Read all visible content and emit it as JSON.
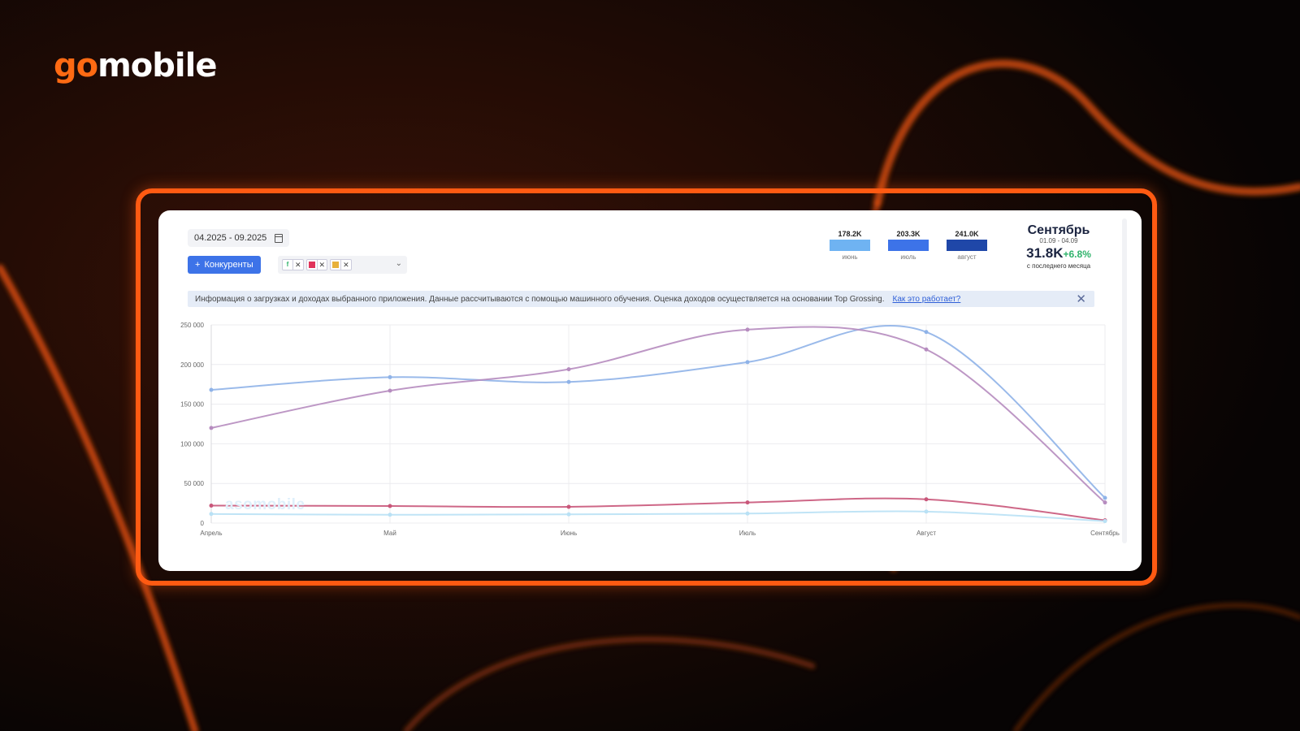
{
  "brand": {
    "logo_go": "go",
    "logo_rest": "mobile"
  },
  "toolbar": {
    "date_range": "04.2025 - 09.2025",
    "competitors_label": "Конкуренты",
    "competitors_plus": "+",
    "competitor_chips": [
      {
        "icon": "f",
        "color": "#2fb36b"
      },
      {
        "icon": "",
        "color": "#e0335a"
      },
      {
        "icon": "",
        "color": "#e8b13a"
      }
    ]
  },
  "stats": [
    {
      "value": "178.2K",
      "label": "июнь",
      "color": "#6fb3f2"
    },
    {
      "value": "203.3K",
      "label": "июль",
      "color": "#3d73e8"
    },
    {
      "value": "241.0K",
      "label": "август",
      "color": "#1f47a8"
    }
  ],
  "summary": {
    "month": "Сентябрь",
    "range": "01.09 - 04.09",
    "total": "31.8K",
    "change": "+6.8%",
    "caption": "с последнего месяца",
    "change_color": "#2fb36b"
  },
  "info": {
    "text": "Информация о загрузках и доходах выбранного приложения. Данные рассчитываются с помощью машинного обучения. Оценка доходов осуществляется на основании Top Grossing.",
    "link": "Как это работает?",
    "close": "✕"
  },
  "watermark": "asomobile",
  "chart_data": {
    "type": "line",
    "categories": [
      "Апрель",
      "Май",
      "Июнь",
      "Июль",
      "Август",
      "Сентябрь"
    ],
    "y_ticks": [
      "0",
      "50 000",
      "100 000",
      "150 000",
      "200 000",
      "250 000"
    ],
    "ylim": [
      0,
      250000
    ],
    "grid": true,
    "series": [
      {
        "color": "#8fb3e8",
        "values": [
          168000,
          184000,
          178000,
          203000,
          241000,
          31800
        ]
      },
      {
        "color": "#b68cbf",
        "values": [
          120000,
          167000,
          194000,
          244000,
          219000,
          26000
        ]
      },
      {
        "color": "#c9577a",
        "values": [
          22000,
          21500,
          20500,
          26000,
          30000,
          3500
        ]
      },
      {
        "color": "#b9e1f5",
        "values": [
          11500,
          10500,
          11000,
          12000,
          14500,
          2500
        ]
      }
    ]
  }
}
